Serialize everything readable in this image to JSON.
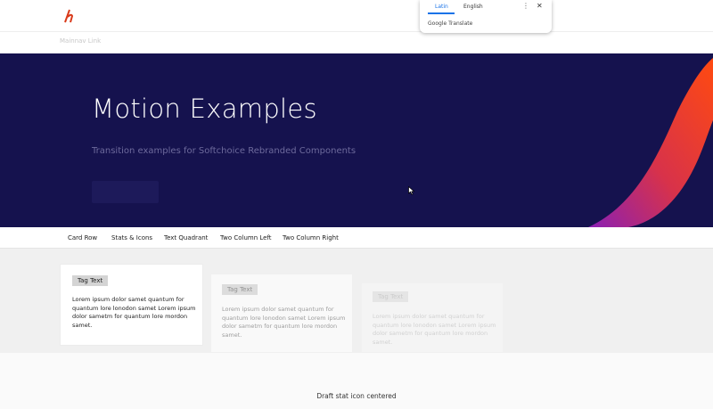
{
  "header": {
    "logo_icon": "softchoice-logo-icon",
    "brand_color": "#d93a1a"
  },
  "main_nav": {
    "link": "Mainnav Link"
  },
  "hero": {
    "title": "Motion Examples",
    "subtitle": "Transition examples for Softchoice Rebranded Components",
    "background": "#15124e"
  },
  "tabs": [
    "Card Row",
    "Stats & Icons",
    "Text Quadrant",
    "Two Column Left",
    "Two Column Right"
  ],
  "cards": [
    {
      "tag": "Tag Text",
      "text": [
        "Lorem ipsum dolor samet quantum for",
        "quantum lore lonodon samet Lorem ipsum",
        "dolor sametm for quantum lore mordon",
        "samet."
      ]
    },
    {
      "tag": "Tag Text",
      "text": [
        "Lorem ipsum dolor samet quantum for",
        "quantum lore lonodon samet Lorem ipsum",
        "dolor sametm for quantum lore mordon",
        "samet."
      ]
    },
    {
      "tag": "Tag Text",
      "text": [
        "Lorem ipsum dolor samet quantum for",
        "quantum lore lonodon samet Lorem ipsum",
        "dolor sametm for quantum lore mordon",
        "samet."
      ]
    }
  ],
  "footer_section": {
    "text": "Draft stat icon centered"
  },
  "translate_popup": {
    "source_language": "Latin",
    "target_language": "English",
    "brand": "Google Translate",
    "more_icon": "more-vert-icon",
    "close_icon": "close-icon"
  }
}
